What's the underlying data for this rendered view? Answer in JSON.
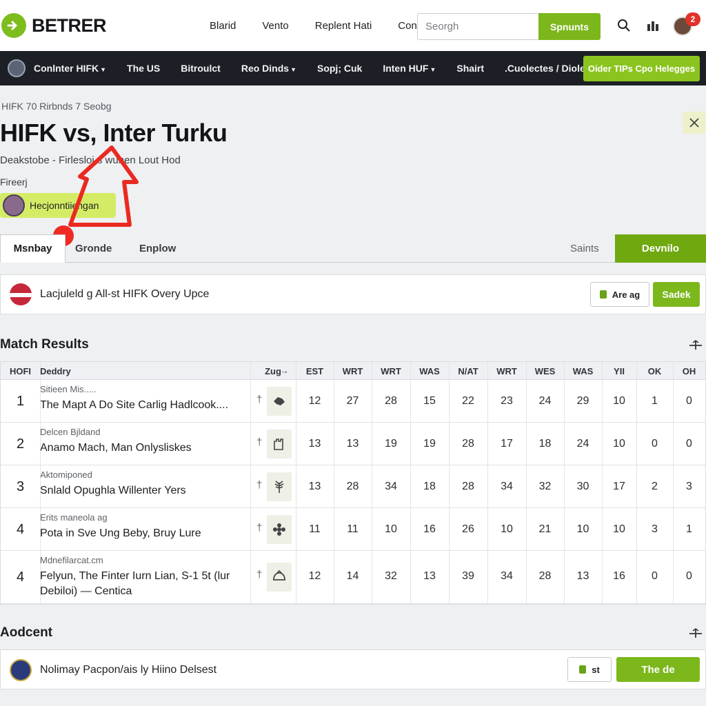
{
  "header": {
    "logo_text": "BETRER",
    "nav": [
      "Blarid",
      "Vento",
      "Replent Hati",
      "Conutr"
    ],
    "search_placeholder": "Seorgh",
    "search_button": "Spnunts",
    "notification_count": "2"
  },
  "darknav": {
    "items": [
      {
        "label": "Conlnter HIFK",
        "dropdown": true
      },
      {
        "label": "The US",
        "dropdown": false
      },
      {
        "label": "Bitroulct",
        "dropdown": false
      },
      {
        "label": "Reo Dinds",
        "dropdown": true
      },
      {
        "label": "Sopj; Cuk",
        "dropdown": false
      },
      {
        "label": "Inten HUF",
        "dropdown": true
      },
      {
        "label": "Shairt",
        "dropdown": false
      },
      {
        "label": ".Cuolectes / Diole",
        "dropdown": false
      }
    ],
    "cta": "Oider TIPs Cpo Helegges"
  },
  "page": {
    "breadcrumb": "HIFK 70 Rirbnds 7 Seobg",
    "title": "HIFK vs, Inter Turku",
    "subtitle": "Deakstobe - Firlesloi s wunen Lout Hod",
    "small_label": "Fireerj",
    "user_chip": "Hecjonntiiengan"
  },
  "tabs": {
    "items": [
      "Msnbay",
      "Gronde",
      "Enplow"
    ],
    "active_index": 0,
    "right_link": "Saints",
    "right_button": "Devnilo"
  },
  "banner": {
    "text": "Lacjuleld g All-st HIFK Overy Upce",
    "outline_button": "Are ag",
    "green_button": "Sadek"
  },
  "match_results": {
    "title": "Match Results",
    "columns": [
      "HOFI",
      "Deddry",
      "Zug",
      "EST",
      "WRT",
      "WRT",
      "WAS",
      "N/AT",
      "WRT",
      "WES",
      "WAS",
      "YII",
      "OK",
      "OH"
    ],
    "rows": [
      {
        "rank": "1",
        "sub": "Sitieen Mis.....",
        "name": "The Mapt A Do Site Carlig Hadlcook....",
        "mark": "†",
        "icon": "badge-icon",
        "values": [
          "12",
          "27",
          "28",
          "15",
          "22",
          "23",
          "24",
          "29",
          "10",
          "1",
          "0"
        ]
      },
      {
        "rank": "2",
        "sub": "Delcen Bjldand",
        "name": "Anamo Mach, Man Onlysliskes",
        "mark": "†",
        "icon": "castle-icon",
        "values": [
          "13",
          "13",
          "19",
          "19",
          "28",
          "17",
          "18",
          "24",
          "10",
          "0",
          "0"
        ]
      },
      {
        "rank": "3",
        "sub": "Aktomiponed",
        "name": "Snlald Opughla Willenter Yers",
        "mark": "†",
        "icon": "wheat-icon",
        "values": [
          "13",
          "28",
          "34",
          "18",
          "28",
          "34",
          "32",
          "30",
          "17",
          "2",
          "3"
        ]
      },
      {
        "rank": "4",
        "sub": "Erits maneola ag",
        "name": "Pota in Sve Ung Beby, Bruy Lure",
        "mark": "†",
        "icon": "flower-icon",
        "values": [
          "11",
          "11",
          "10",
          "16",
          "26",
          "10",
          "21",
          "10",
          "10",
          "3",
          "1"
        ]
      },
      {
        "rank": "4",
        "sub": "Mdnefilarcat.cm",
        "name": "Felyun, The Finter Iurn Lian, S-1 5t (lur Debiloi) — Centica",
        "mark": "†",
        "icon": "helmet-icon",
        "values": [
          "12",
          "14",
          "32",
          "13",
          "39",
          "34",
          "28",
          "13",
          "16",
          "0",
          "0"
        ]
      }
    ]
  },
  "adcent": {
    "title": "Aodcent",
    "text": "Nolimay Pacpon/ais ly Hiino Delsest",
    "outline_button": "st",
    "green_button": "The de"
  }
}
